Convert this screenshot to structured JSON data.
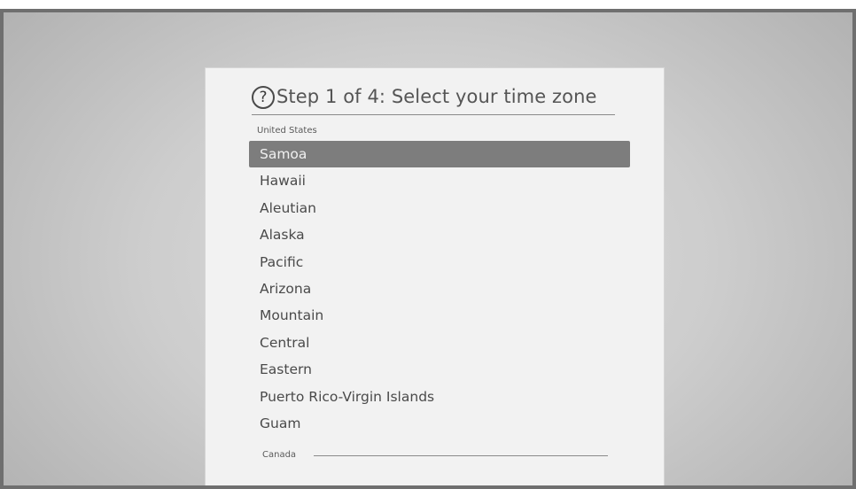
{
  "dialog": {
    "help_icon": "?",
    "title": "Step 1 of 4: Select your time zone",
    "section_us": "United States",
    "section_canada": "Canada",
    "items": [
      {
        "label": "Samoa",
        "selected": true
      },
      {
        "label": "Hawaii",
        "selected": false
      },
      {
        "label": "Aleutian",
        "selected": false
      },
      {
        "label": "Alaska",
        "selected": false
      },
      {
        "label": "Pacific",
        "selected": false
      },
      {
        "label": "Arizona",
        "selected": false
      },
      {
        "label": "Mountain",
        "selected": false
      },
      {
        "label": "Central",
        "selected": false
      },
      {
        "label": "Eastern",
        "selected": false
      },
      {
        "label": "Puerto Rico-Virgin Islands",
        "selected": false
      },
      {
        "label": "Guam",
        "selected": false
      }
    ]
  },
  "colors": {
    "selected_background": "#7d7d7d",
    "dialog_background": "#f2f2f2",
    "text": "#4a4a4a"
  }
}
